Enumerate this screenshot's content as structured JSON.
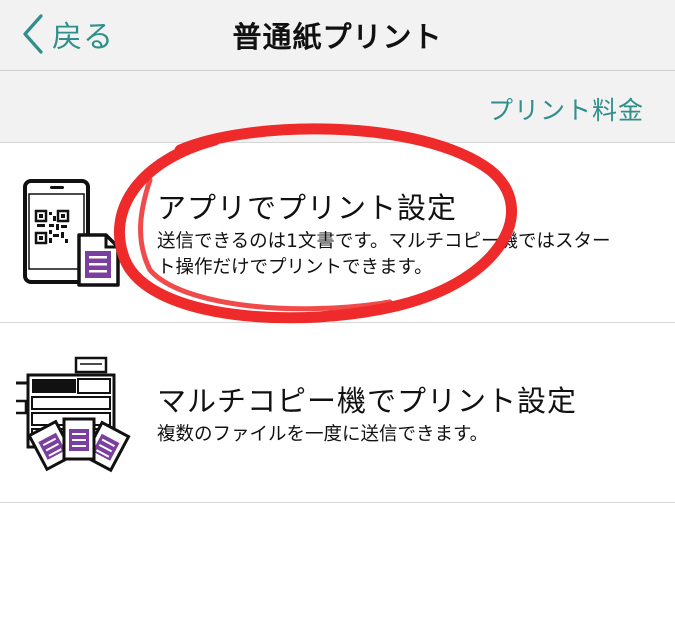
{
  "nav": {
    "back_label": "戻る",
    "title": "普通紙プリント"
  },
  "subbar": {
    "fee_link": "プリント料金"
  },
  "options": [
    {
      "title": "アプリでプリント設定",
      "desc_line1": "送信できるのは1文書です。マルチコピー機ではスター",
      "desc_line2": "ト操作だけでプリントできます。"
    },
    {
      "title": "マルチコピー機でプリント設定",
      "desc_line1": "複数のファイルを一度に送信できます。"
    }
  ],
  "colors": {
    "accent": "#2f8f8a",
    "doc_purple": "#7b3fa0",
    "annotation_red": "#ee2a2a"
  },
  "icons": [
    "chevron-left-icon",
    "phone-qr-document-icon",
    "multicopy-machine-icon"
  ]
}
